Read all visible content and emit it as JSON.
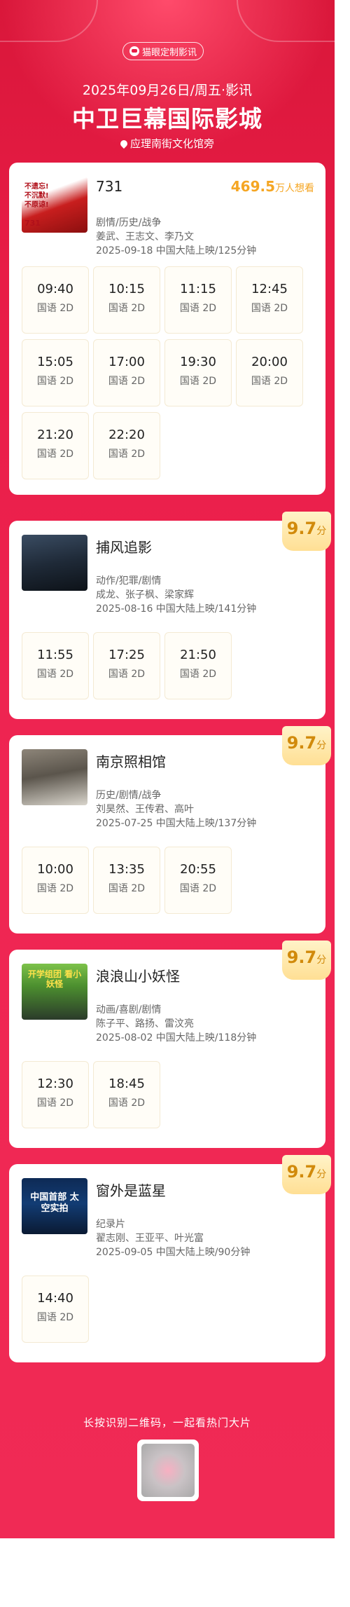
{
  "header": {
    "brand": "猫眼定制影讯",
    "date_line": "2025年09月26日/周五·影讯",
    "cinema_name": "中卫巨幕国际影城",
    "address": "应理南街文化馆旁"
  },
  "colors": {
    "bg": "#ef2552",
    "gold": "#f5a623",
    "score": "#d18a0b"
  },
  "movies": [
    {
      "title": "731",
      "want_num": "469.5",
      "want_unit": "万人想看",
      "genre": "剧情/历史/战争",
      "cast": "姜武、王志文、李乃文",
      "release": "2025-09-18 中国大陆上映/125分钟",
      "poster_text": "不遗忘! 不沉默! 不原谅!",
      "showtimes": [
        {
          "time": "09:40",
          "lang": "国语 2D"
        },
        {
          "time": "10:15",
          "lang": "国语 2D"
        },
        {
          "time": "11:15",
          "lang": "国语 2D"
        },
        {
          "time": "12:45",
          "lang": "国语 2D"
        },
        {
          "time": "15:05",
          "lang": "国语 2D"
        },
        {
          "time": "17:00",
          "lang": "国语 2D"
        },
        {
          "time": "19:30",
          "lang": "国语 2D"
        },
        {
          "time": "20:00",
          "lang": "国语 2D"
        },
        {
          "time": "21:20",
          "lang": "国语 2D"
        },
        {
          "time": "22:20",
          "lang": "国语 2D"
        }
      ]
    },
    {
      "title": "捕风追影",
      "score": "9.7",
      "score_unit": "分",
      "genre": "动作/犯罪/剧情",
      "cast": "成龙、张子枫、梁家辉",
      "release": "2025-08-16 中国大陆上映/141分钟",
      "showtimes": [
        {
          "time": "11:55",
          "lang": "国语 2D"
        },
        {
          "time": "17:25",
          "lang": "国语 2D"
        },
        {
          "time": "21:50",
          "lang": "国语 2D"
        }
      ]
    },
    {
      "title": "南京照相馆",
      "score": "9.7",
      "score_unit": "分",
      "genre": "历史/剧情/战争",
      "cast": "刘昊然、王传君、高叶",
      "release": "2025-07-25 中国大陆上映/137分钟",
      "showtimes": [
        {
          "time": "10:00",
          "lang": "国语 2D"
        },
        {
          "time": "13:35",
          "lang": "国语 2D"
        },
        {
          "time": "20:55",
          "lang": "国语 2D"
        }
      ]
    },
    {
      "title": "浪浪山小妖怪",
      "score": "9.7",
      "score_unit": "分",
      "genre": "动画/喜剧/剧情",
      "cast": "陈子平、路扬、雷汶亮",
      "release": "2025-08-02 中国大陆上映/118分钟",
      "poster_text": "开学组团 看小妖怪",
      "showtimes": [
        {
          "time": "12:30",
          "lang": "国语 2D"
        },
        {
          "time": "18:45",
          "lang": "国语 2D"
        }
      ]
    },
    {
      "title": "窗外是蓝星",
      "score": "9.7",
      "score_unit": "分",
      "genre": "纪录片",
      "cast": "翟志刚、王亚平、叶光富",
      "release": "2025-09-05 中国大陆上映/90分钟",
      "poster_text": "中国首部 太空实拍",
      "showtimes": [
        {
          "time": "14:40",
          "lang": "国语 2D"
        }
      ]
    }
  ],
  "footer": {
    "qr_hint": "长按识别二维码，一起看热门大片"
  }
}
